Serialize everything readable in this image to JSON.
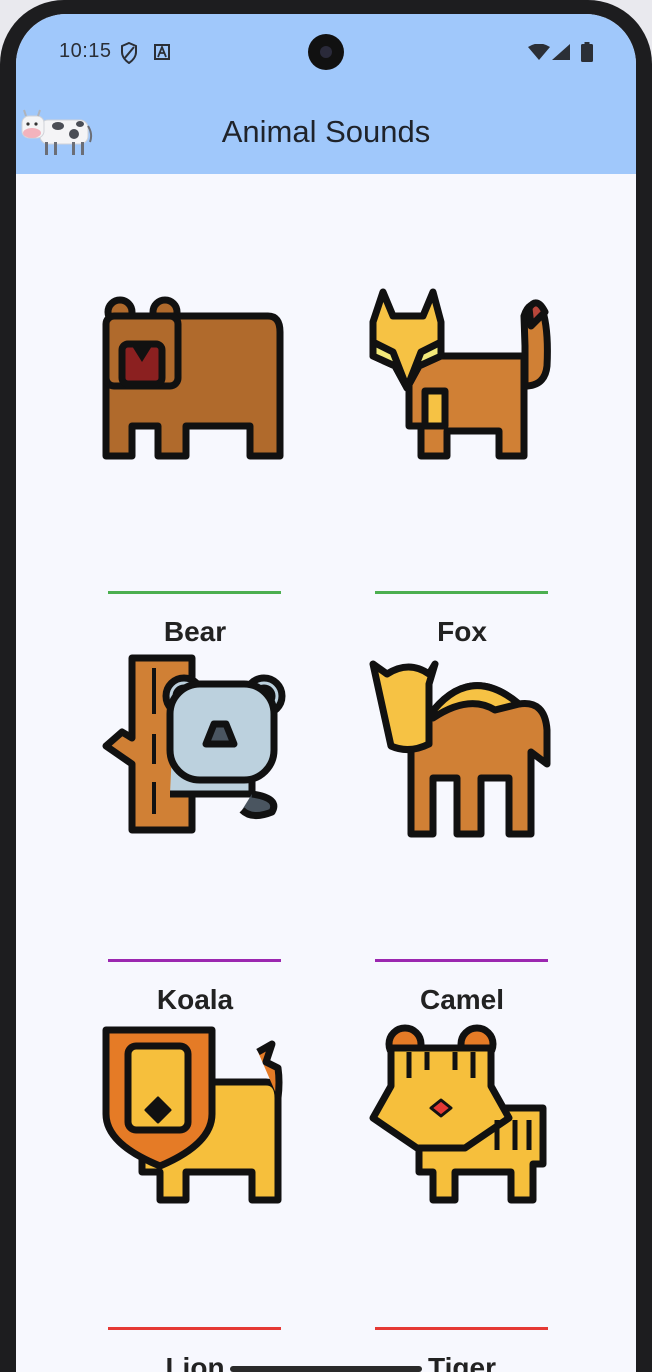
{
  "status_bar": {
    "time": "10:15",
    "icons": [
      "shield-icon",
      "font-a-icon",
      "wifi-icon",
      "signal-icon",
      "battery-icon"
    ]
  },
  "app_bar": {
    "title": "Animal Sounds",
    "logo_icon": "cow-icon",
    "background": "#a0c8fb"
  },
  "animals": [
    {
      "name": "Bear",
      "icon": "bear-icon",
      "accent": "#4caf50"
    },
    {
      "name": "Fox",
      "icon": "fox-icon",
      "accent": "#4caf50"
    },
    {
      "name": "Koala",
      "icon": "koala-icon",
      "accent": "#9c27b0"
    },
    {
      "name": "Camel",
      "icon": "camel-icon",
      "accent": "#9c27b0"
    },
    {
      "name": "Lion",
      "icon": "lion-icon",
      "accent": "#e53935"
    },
    {
      "name": "Tiger",
      "icon": "tiger-icon",
      "accent": "#e53935"
    }
  ]
}
